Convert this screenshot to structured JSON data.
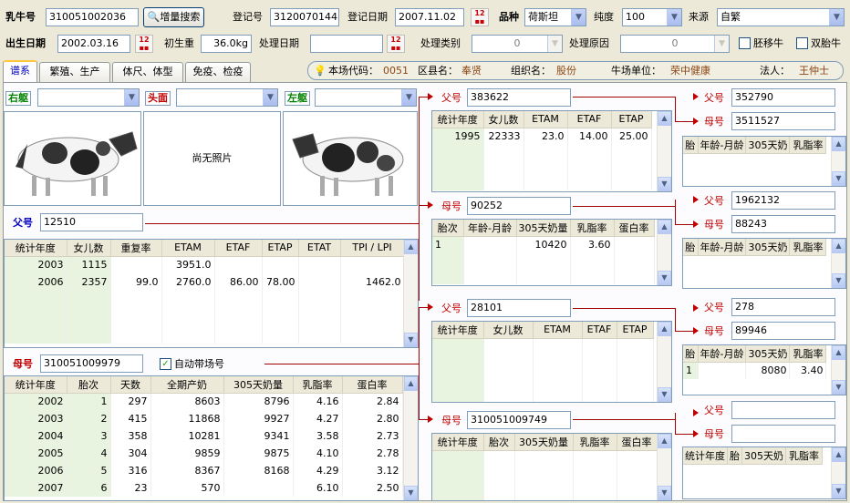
{
  "top": {
    "ear_tag_label": "乳牛号",
    "ear_tag_value": "310051002036",
    "search_btn": "增量搜索",
    "reg_no_label": "登记号",
    "reg_no_value": "3120070144",
    "reg_date_label": "登记日期",
    "reg_date_value": "2007.11.02",
    "breed_label": "品种",
    "breed_value": "荷斯坦",
    "purity_label": "纯度",
    "purity_value": "100",
    "source_label": "来源",
    "source_value": "自繁",
    "birth_date_label": "出生日期",
    "birth_date_value": "2002.03.16",
    "birth_weight_label": "初生重",
    "birth_weight_value": "36.0kg",
    "process_date_label": "处理日期",
    "process_date_value": "",
    "process_type_label": "处理类别",
    "process_type_value": "0",
    "process_reason_label": "处理原因",
    "process_reason_value": "0",
    "embryo_label": "胚移牛",
    "twin_label": "双胎牛"
  },
  "tabs": [
    "谱系",
    "繁殖、生产",
    "体尺、体型",
    "免疫、检疫"
  ],
  "info": {
    "farm_code_label": "本场代码：",
    "farm_code_value": "0051",
    "county_label": "区县名：",
    "county_value": "奉贤",
    "org_label": "组织名：",
    "org_value": "股份",
    "unit_label": "牛场单位：",
    "unit_value": "荣中健康",
    "legal_label": "法人：",
    "legal_value": "王仲士"
  },
  "photos": {
    "right_label": "右躯",
    "head_label": "头面",
    "left_label": "左躯",
    "no_photo": "尚无照片"
  },
  "sire": {
    "label": "父号",
    "value": "12510",
    "columns": [
      "统计年度",
      "女儿数",
      "重复率",
      "ETAM",
      "ETAF",
      "ETAP",
      "ETAT",
      "TPI / LPI"
    ],
    "rows": [
      [
        "2003",
        "1115",
        "",
        "3951.0",
        "",
        "",
        "",
        ""
      ],
      [
        "2006",
        "2357",
        "99.0",
        "2760.0",
        "86.00",
        "78.00",
        "",
        "1462.0"
      ]
    ]
  },
  "dam": {
    "label": "母号",
    "value": "310051009979",
    "auto_label": "自动带场号",
    "columns": [
      "统计年度",
      "胎次",
      "天数",
      "全期产奶",
      "305天奶量",
      "乳脂率",
      "蛋白率"
    ],
    "rows": [
      [
        "2002",
        "1",
        "297",
        "8603",
        "8796",
        "4.16",
        "2.84"
      ],
      [
        "2003",
        "2",
        "415",
        "11868",
        "9927",
        "4.27",
        "2.80"
      ],
      [
        "2004",
        "3",
        "358",
        "10281",
        "9341",
        "3.58",
        "2.73"
      ],
      [
        "2005",
        "4",
        "304",
        "9859",
        "9875",
        "4.10",
        "2.78"
      ],
      [
        "2006",
        "5",
        "316",
        "8367",
        "8168",
        "4.29",
        "3.12"
      ],
      [
        "2007",
        "6",
        "23",
        "570",
        "",
        "6.10",
        "2.50"
      ]
    ]
  },
  "ss": {
    "label": "父号",
    "value": "383622",
    "columns": [
      "统计年度",
      "女儿数",
      "ETAM",
      "ETAF",
      "ETAP"
    ],
    "rows": [
      [
        "1995",
        "22333",
        "23.0",
        "14.00",
        "25.00"
      ]
    ]
  },
  "sd": {
    "label": "母号",
    "value": "90252",
    "columns": [
      "胎次",
      "年龄-月龄",
      "305天奶量",
      "乳脂率",
      "蛋白率"
    ],
    "rows": [
      [
        "1",
        "",
        "10420",
        "3.60",
        ""
      ]
    ]
  },
  "ds": {
    "label": "父号",
    "value": "28101",
    "columns": [
      "统计年度",
      "女儿数",
      "ETAM",
      "ETAF",
      "ETAP"
    ],
    "rows": []
  },
  "dd": {
    "label": "母号",
    "value": "310051009749",
    "columns": [
      "统计年度",
      "胎次",
      "305天奶量",
      "乳脂率",
      "蛋白率"
    ],
    "rows": []
  },
  "g1": {
    "sire_label": "父号",
    "sire_value": "352790",
    "dam_label": "母号",
    "dam_value": "3511527",
    "columns": [
      "胎",
      "年龄-月龄",
      "305天奶",
      "乳脂率"
    ],
    "rows": []
  },
  "g2": {
    "sire_label": "父号",
    "sire_value": "1962132",
    "dam_label": "母号",
    "dam_value": "88243",
    "columns": [
      "胎",
      "年龄-月龄",
      "305天奶",
      "乳脂率"
    ],
    "rows": []
  },
  "g3": {
    "sire_label": "父号",
    "sire_value": "278",
    "dam_label": "母号",
    "dam_value": "89946",
    "columns": [
      "胎",
      "年龄-月龄",
      "305天奶",
      "乳脂率"
    ],
    "rows": [
      [
        "1",
        "",
        "8080",
        "3.40"
      ]
    ]
  },
  "g4": {
    "sire_label": "父号",
    "sire_value": "",
    "dam_label": "母号",
    "dam_value": "",
    "columns": [
      "统计年度",
      "胎",
      "305天奶",
      "乳脂率"
    ],
    "rows": []
  }
}
